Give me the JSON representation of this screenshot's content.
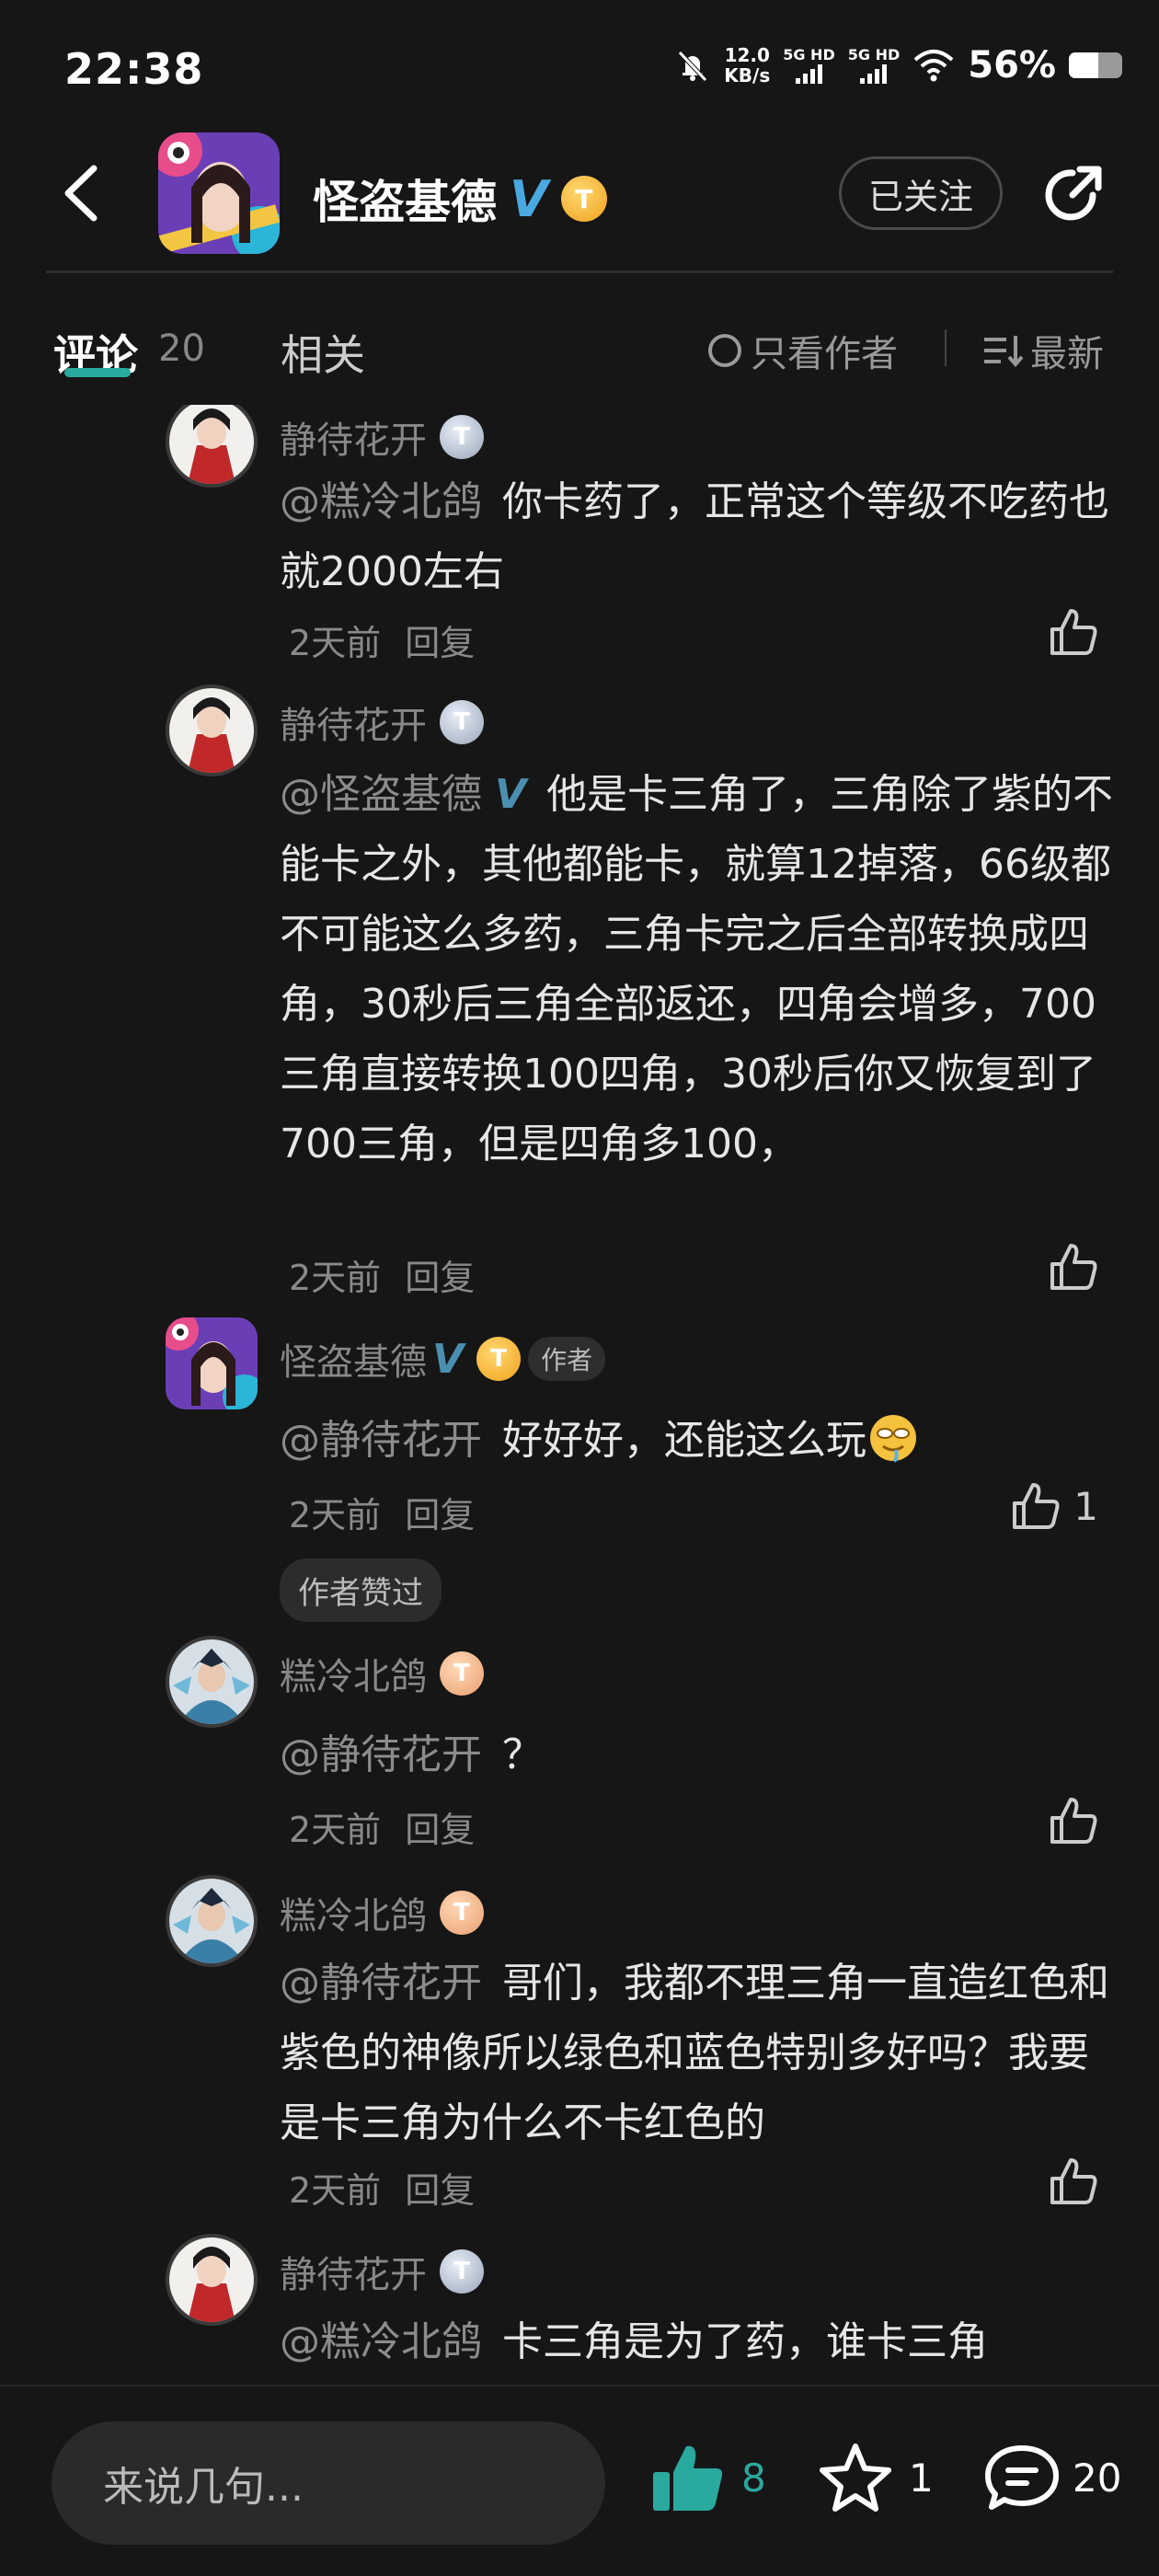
{
  "status_bar": {
    "time": "22:38",
    "net_speed_value": "12.0",
    "net_speed_unit": "KB/s",
    "signal1_label": "5G HD",
    "signal2_label": "5G HD",
    "battery_percent": "56%",
    "battery_level": 0.56
  },
  "header": {
    "title": "怪盗基德",
    "verified_mark": "V",
    "tier_badge": "T",
    "follow_label": "已关注"
  },
  "tabs": {
    "comments_label": "评论",
    "comments_count": "20",
    "related_label": "相关",
    "author_only_label": "只看作者",
    "sort_label": "最新"
  },
  "comments": [
    {
      "user": "静待花开",
      "badge": "T",
      "mention": "@糕冷北鸽",
      "text": "你卡药了，正常这个等级不吃药也就2000左右",
      "time": "2天前",
      "reply_label": "回复"
    },
    {
      "user": "静待花开",
      "badge": "T",
      "mention": "@怪盗基德",
      "mention_mark": "V",
      "text": "他是卡三角了，三角除了紫的不能卡之外，其他都能卡，就算12掉落，66级都不可能这么多药，三角卡完之后全部转换成四角，30秒后三角全部返还，四角会增多，700三角直接转换100四角，30秒后你又恢复到了700三角，但是四角多100，",
      "time": "2天前",
      "reply_label": "回复"
    },
    {
      "user": "怪盗基德",
      "user_mark": "V",
      "badge": "T",
      "author_tag": "作者",
      "mention": "@静待花开",
      "text": "好好好，还能这么玩",
      "time": "2天前",
      "reply_label": "回复",
      "like_count": "1",
      "liked_badge": "作者赞过"
    },
    {
      "user": "糕冷北鸽",
      "badge": "T",
      "mention": "@静待花开",
      "text": "？",
      "time": "2天前",
      "reply_label": "回复"
    },
    {
      "user": "糕冷北鸽",
      "badge": "T",
      "mention": "@静待花开",
      "text": "哥们，我都不理三角一直造红色和紫色的神像所以绿色和蓝色特别多好吗？我要是卡三角为什么不卡红色的",
      "time": "2天前",
      "reply_label": "回复"
    },
    {
      "user": "静待花开",
      "badge": "T",
      "mention": "@糕冷北鸽",
      "text": "卡三角是为了药，谁卡三角"
    }
  ],
  "bottom_bar": {
    "input_placeholder": "来说几句...",
    "like_count": "8",
    "favorite_count": "1",
    "comment_count": "20"
  },
  "colors": {
    "accent": "#2aa99e",
    "background": "#161616",
    "verified": "#4aa8e0",
    "gold_badge": "#f0a21c"
  }
}
